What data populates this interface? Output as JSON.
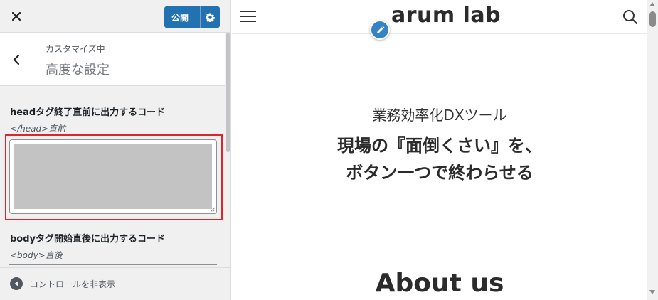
{
  "topbar": {
    "close_icon": "close-icon",
    "publish_label": "公開",
    "publish_settings_icon": "gear-icon"
  },
  "section": {
    "back_icon": "chevron-left-icon",
    "customizing_label": "カスタマイズ中",
    "title": "高度な設定"
  },
  "controls": {
    "head_code": {
      "title": "headタグ終了直前に出力するコード",
      "description": "</head>直前",
      "value": ""
    },
    "body_code": {
      "title": "bodyタグ開始直後に出力するコード",
      "description": "<body>直後"
    }
  },
  "footer": {
    "collapse_label": "コントロールを非表示"
  },
  "preview": {
    "site_title": "arum lab",
    "hero_subtitle": "業務効率化DXツール",
    "hero_line1": "現場の『面倒くさい』を、",
    "hero_line2": "ボタン一つで終わらせる",
    "about_heading": "About us"
  },
  "colors": {
    "publish_button": "#2271b1",
    "highlight_border": "#e0242b",
    "edit_shortcut": "#3582c4",
    "textarea_fill": "#c3c3c3"
  }
}
